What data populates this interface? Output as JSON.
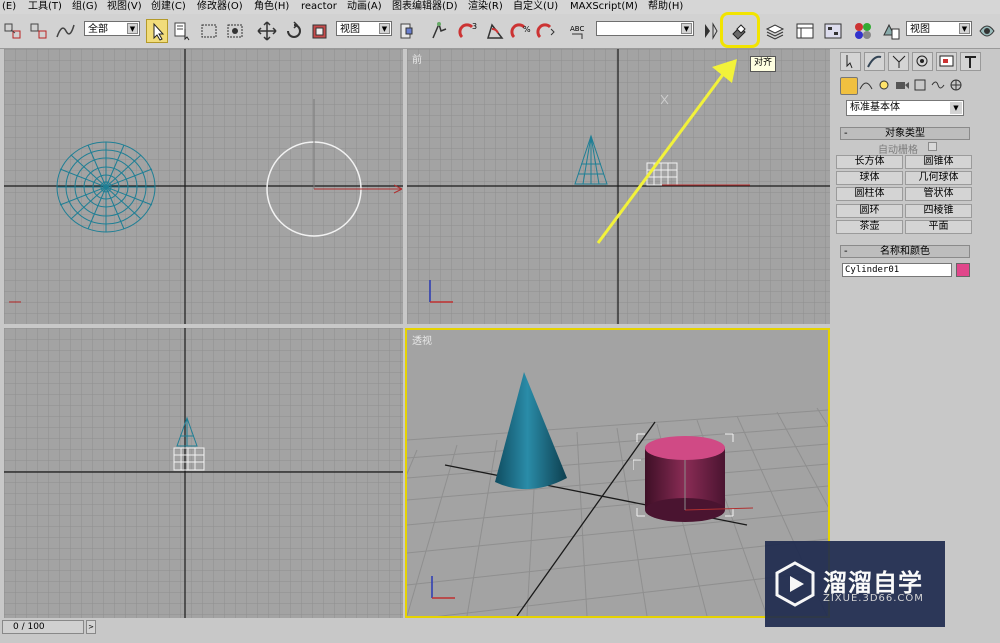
{
  "menu": [
    "(E)",
    "工具(T)",
    "组(G)",
    "视图(V)",
    "创建(C)",
    "修改器(O)",
    "角色(H)",
    "reactor",
    "动画(A)",
    "图表编辑器(D)",
    "渲染(R)",
    "自定义(U)",
    "MAXScript(M)",
    "帮助(H)"
  ],
  "toolbar": {
    "selection_filter": "全部",
    "ref_coord": "视图",
    "named_selection": "",
    "render_view": "视图",
    "tooltip": "对齐",
    "highlight_color": "#f2e400"
  },
  "viewports": {
    "top_right_label": "前",
    "bottom_right_label": "透视",
    "active_border_color": "#e6d300"
  },
  "panel": {
    "category_dropdown": "标准基本体",
    "object_type_header": "对象类型",
    "autogrid_label": "自动栅格",
    "object_buttons": [
      "长方体",
      "圆锥体",
      "球体",
      "几何球体",
      "圆柱体",
      "管状体",
      "圆环",
      "四棱锥",
      "茶壶",
      "平面"
    ],
    "name_color_header": "名称和颜色",
    "object_name": "Cylinder01",
    "object_color": "#e0468a"
  },
  "status": {
    "time": "0 / 100"
  },
  "watermark": {
    "title": "溜溜自学",
    "subtitle": "ZIXUE.3D66.COM"
  }
}
